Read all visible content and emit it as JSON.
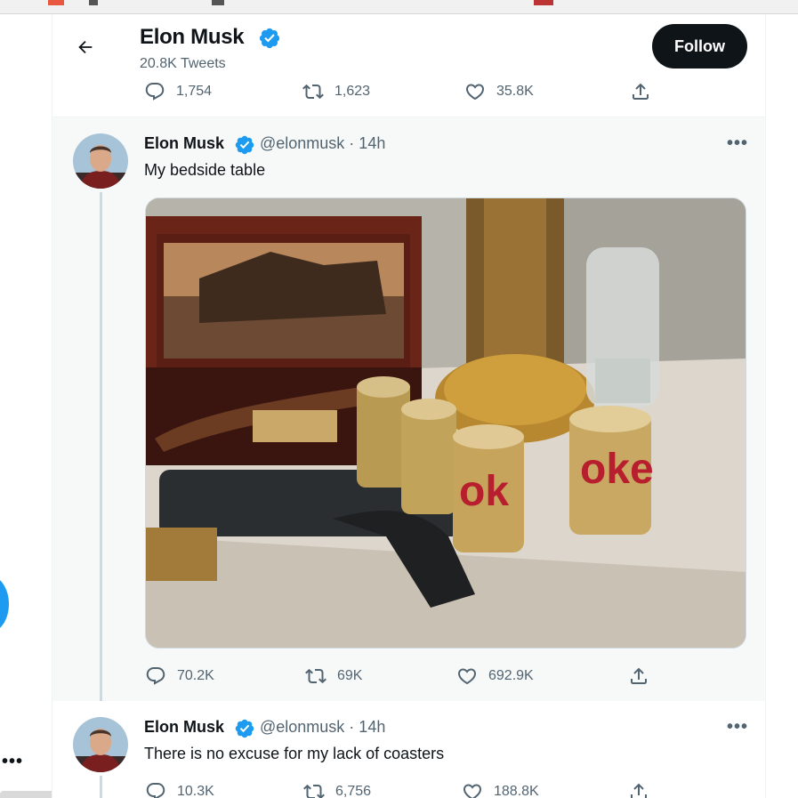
{
  "profile_header": {
    "name": "Elon Musk",
    "tweet_count": "20.8K Tweets",
    "follow_label": "Follow"
  },
  "previous_tweet": {
    "replies": "1,754",
    "retweets": "1,623",
    "likes": "35.8K"
  },
  "tweets": [
    {
      "name": "Elon Musk",
      "handle": "@elonmusk · 14h",
      "text": "My bedside table",
      "replies": "70.2K",
      "retweets": "69K",
      "likes": "692.9K",
      "image_description": "bedside table with guns and Diet Coke cans"
    },
    {
      "name": "Elon Musk",
      "handle": "@elonmusk · 14h",
      "text": "There is no excuse for my lack of coasters",
      "replies": "10.3K",
      "retweets": "6,756",
      "likes": "188.8K"
    }
  ],
  "more_label": "•••",
  "colors": {
    "verified": "#1d9bf0",
    "text_secondary": "#536471",
    "follow_bg": "#0f1419",
    "hover_bg": "#f7f9f9"
  },
  "icons": [
    "back-arrow-icon",
    "verified-badge-icon",
    "reply-icon",
    "retweet-icon",
    "like-icon",
    "share-icon",
    "more-icon"
  ]
}
